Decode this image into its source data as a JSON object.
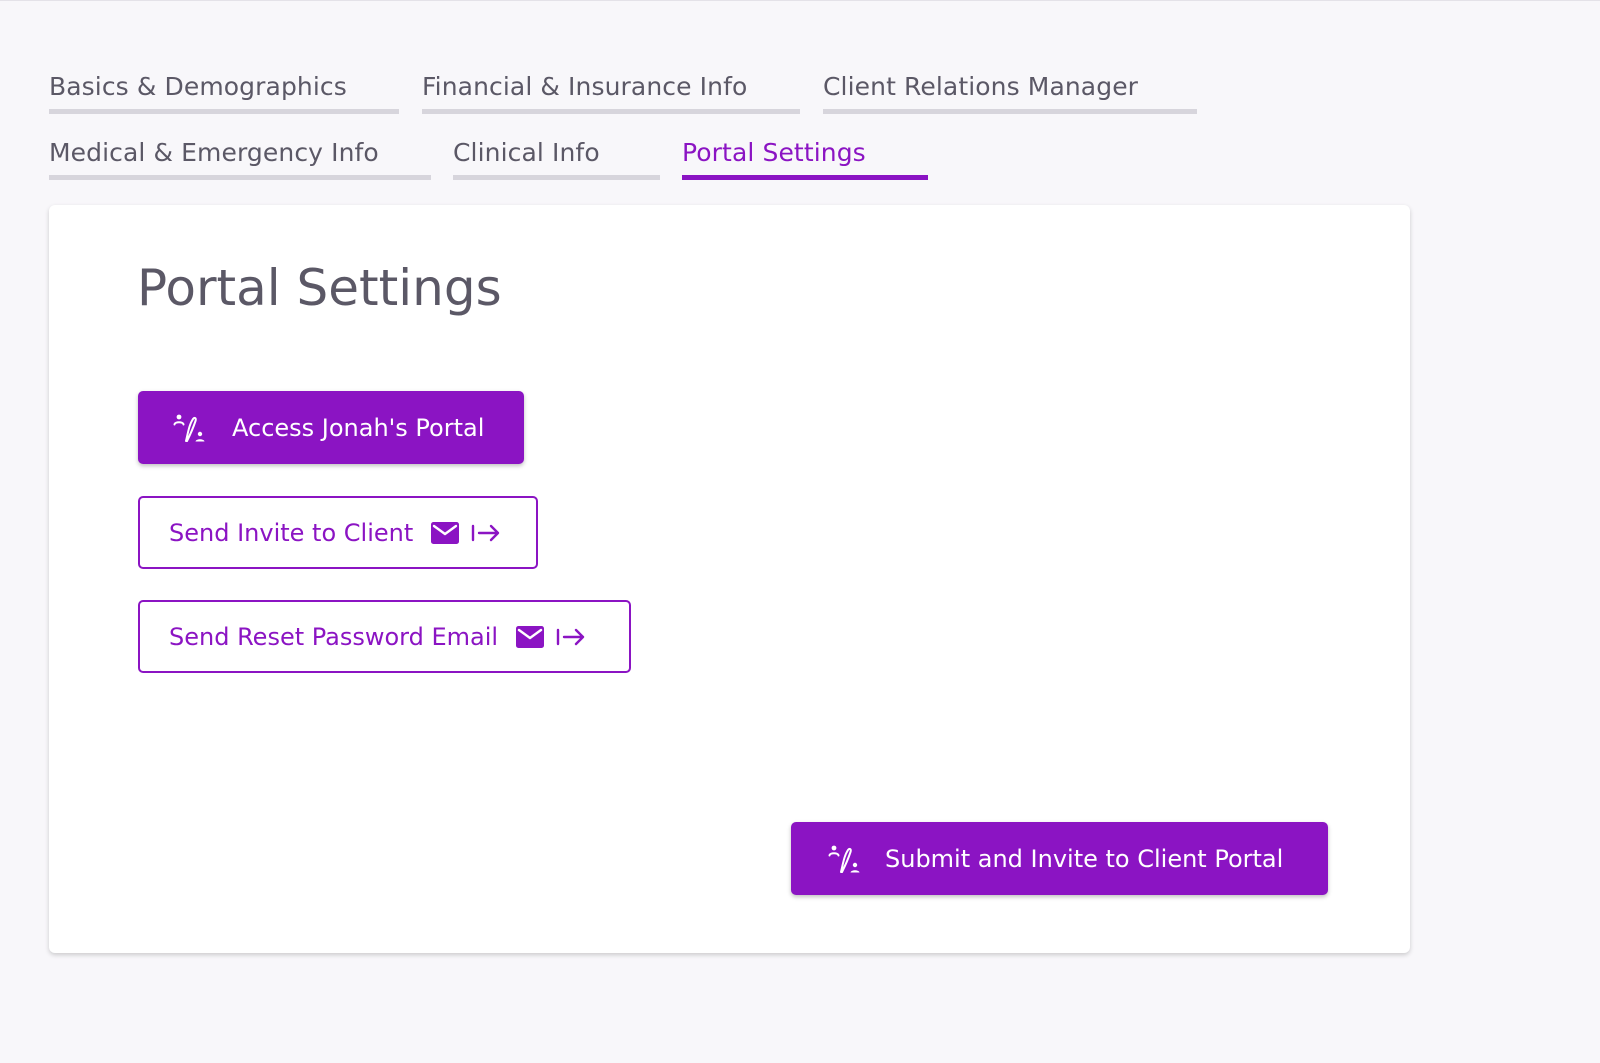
{
  "tabs": [
    {
      "label": "Basics & Demographics",
      "active": false
    },
    {
      "label": "Financial & Insurance Info",
      "active": false
    },
    {
      "label": "Client Relations Manager",
      "active": false
    },
    {
      "label": "Medical & Emergency Info",
      "active": false
    },
    {
      "label": "Clinical Info",
      "active": false
    },
    {
      "label": "Portal Settings",
      "active": true
    }
  ],
  "card": {
    "title": "Portal Settings",
    "access_portal_label": "Access Jonah's Portal",
    "access_portal_icon": "user-sign-icon",
    "send_invite_label": "Send Invite to Client",
    "send_invite_icons": [
      "mail-icon",
      "arrow-right-to-bar-icon"
    ],
    "reset_password_label": "Send Reset Password Email",
    "reset_password_icons": [
      "mail-icon",
      "arrow-right-to-bar-icon"
    ],
    "submit_invite_label": "Submit and Invite to Client Portal",
    "submit_invite_icon": "user-sign-icon"
  },
  "colors": {
    "accent": "#8b14c3",
    "tab_text": "#5b5866",
    "tab_underline": "#d7d5dc",
    "background": "#f8f7fa",
    "card_background": "#ffffff"
  }
}
